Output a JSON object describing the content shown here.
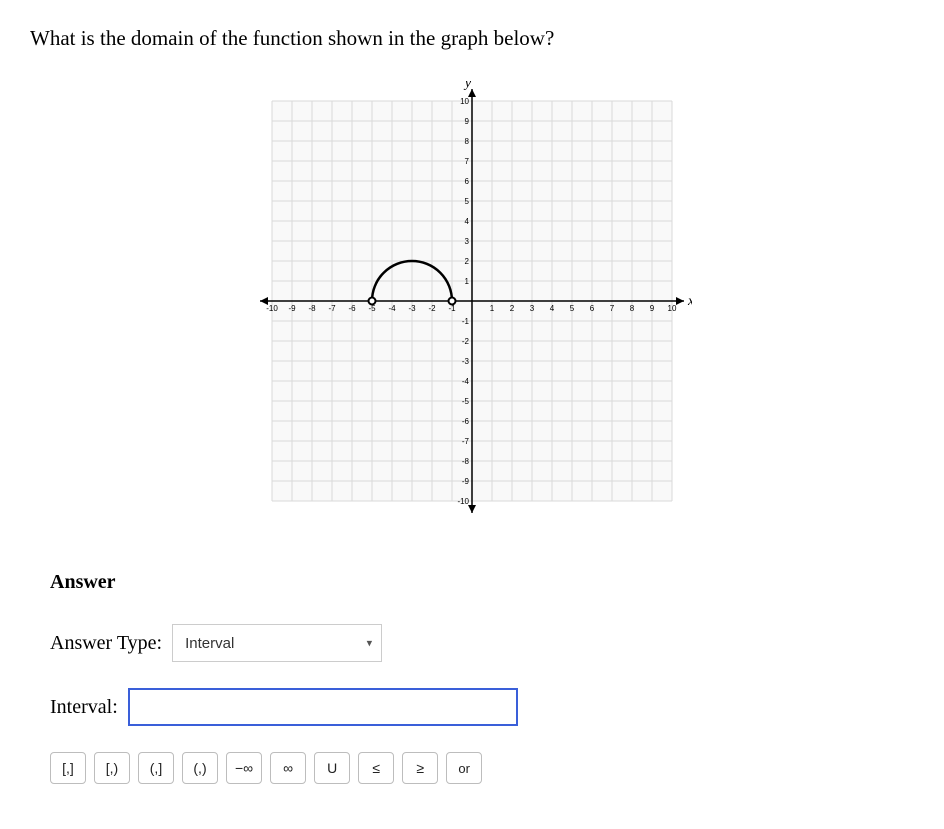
{
  "question": "What is the domain of the function shown in the graph below?",
  "chart_data": {
    "type": "line",
    "title": "",
    "xlabel": "x",
    "ylabel": "y",
    "xlim": [
      -10,
      10
    ],
    "ylim": [
      -10,
      10
    ],
    "x_ticks": [
      -10,
      -9,
      -8,
      -7,
      -6,
      -5,
      -4,
      -3,
      -2,
      -1,
      1,
      2,
      3,
      4,
      5,
      6,
      7,
      8,
      9,
      10
    ],
    "y_ticks": [
      -10,
      -9,
      -8,
      -7,
      -6,
      -5,
      -4,
      -3,
      -2,
      -1,
      1,
      2,
      3,
      4,
      5,
      6,
      7,
      8,
      9,
      10
    ],
    "series": [
      {
        "name": "semicircle",
        "shape": "semicircle-upper",
        "center": [
          -3,
          0
        ],
        "radius": 2,
        "endpoints": [
          [
            -5,
            0
          ],
          [
            -1,
            0
          ]
        ],
        "endpoint_style": "open"
      }
    ]
  },
  "answer": {
    "heading": "Answer",
    "type_label": "Answer Type:",
    "type_options": [
      "Interval"
    ],
    "type_selected": "Interval",
    "interval_label": "Interval:",
    "interval_value": ""
  },
  "symbols": {
    "closed_closed": "[,]",
    "closed_open": "[,)",
    "open_closed": "(,]",
    "open_open": "(,)",
    "neg_inf": "−∞",
    "inf": "∞",
    "union": "U",
    "le": "≤",
    "ge": "≥",
    "or": "or"
  }
}
